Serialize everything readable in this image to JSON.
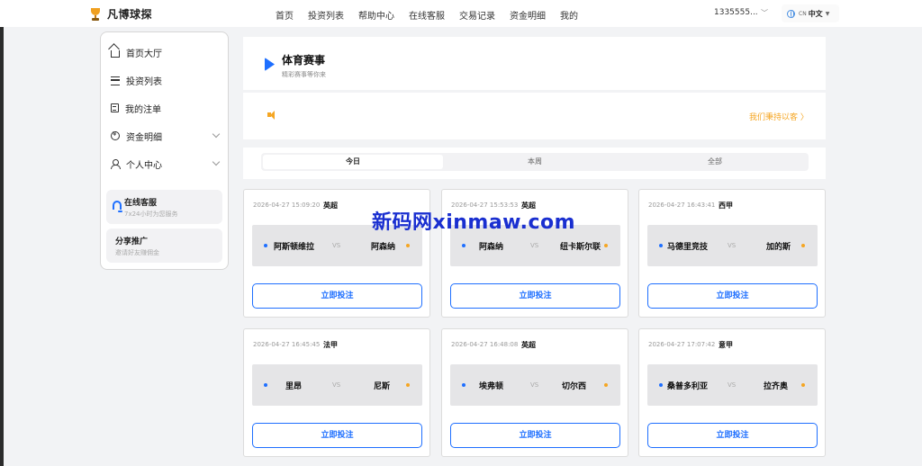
{
  "header": {
    "logo_text": "凡博球探",
    "nav": [
      "首页",
      "投资列表",
      "帮助中心",
      "在线客服",
      "交易记录",
      "资金明细",
      "我的"
    ],
    "phone": "1335555...",
    "lang_code": "CN",
    "lang_name": "中文"
  },
  "sidebar": {
    "items": [
      {
        "label": "首页大厅",
        "icon": "home-icon"
      },
      {
        "label": "投资列表",
        "icon": "list-icon"
      },
      {
        "label": "我的注单",
        "icon": "document-icon"
      },
      {
        "label": "资金明细",
        "icon": "coin-icon"
      },
      {
        "label": "个人中心",
        "icon": "user-icon"
      }
    ],
    "service": {
      "title": "在线客服",
      "subtitle": "7x24小时为您服务"
    },
    "share": {
      "title": "分享推广",
      "subtitle": "邀请好友赚佣金"
    }
  },
  "main": {
    "title": "体育赛事",
    "subtitle": "精彩赛事等你来",
    "notice_link": "我们秉持以客 〉",
    "tabs": [
      "今日",
      "本周",
      "全部"
    ],
    "active_tab": "今日"
  },
  "matches": [
    {
      "time": "2026-04-27 15:09:20",
      "league": "英超",
      "home": "阿斯顿维拉",
      "vs": "VS",
      "away": "阿森纳",
      "button": "立即投注"
    },
    {
      "time": "2026-04-27 15:53:53",
      "league": "英超",
      "home": "阿森纳",
      "vs": "VS",
      "away": "纽卡斯尔联",
      "button": "立即投注"
    },
    {
      "time": "2026-04-27 16:43:41",
      "league": "西甲",
      "home": "马德里竞技",
      "vs": "VS",
      "away": "加的斯",
      "button": "立即投注"
    },
    {
      "time": "2026-04-27 16:45:45",
      "league": "法甲",
      "home": "里昂",
      "vs": "VS",
      "away": "尼斯",
      "button": "立即投注"
    },
    {
      "time": "2026-04-27 16:48:08",
      "league": "英超",
      "home": "埃弗顿",
      "vs": "VS",
      "away": "切尔西",
      "button": "立即投注"
    },
    {
      "time": "2026-04-27 17:07:42",
      "league": "意甲",
      "home": "桑普多利亚",
      "vs": "VS",
      "away": "拉齐奥",
      "button": "立即投注"
    }
  ],
  "watermark": "新码网xinmaw.com",
  "colors": {
    "accent": "#1e6fff",
    "highlight": "#f5a623",
    "background": "#f2f3f5"
  }
}
